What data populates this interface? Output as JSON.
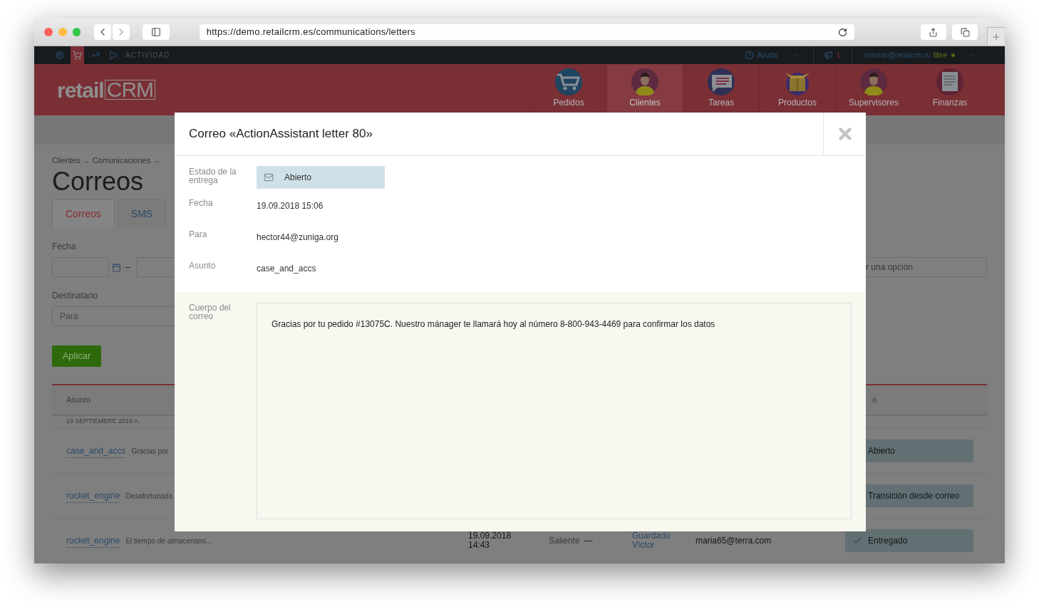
{
  "browser": {
    "url": "https://demo.retailcrm.es/communications/letters"
  },
  "topbar": {
    "icons": [
      {
        "kind": "gear",
        "selected": false
      },
      {
        "kind": "cart",
        "selected": true
      },
      {
        "kind": "chart",
        "selected": false
      },
      {
        "kind": "play",
        "selected": false
      }
    ],
    "section": "ACTIVIDAD",
    "help": "Ayuda",
    "notifications": "1",
    "user": "voronin@retailcrm.ru",
    "plan": "libre"
  },
  "header": {
    "logo_left": "retail",
    "logo_right": "CRM",
    "nav": [
      {
        "label": "Pedidos",
        "kind": "cart",
        "selected": false
      },
      {
        "label": "Clientes",
        "kind": "person",
        "selected": true
      },
      {
        "label": "Tareas",
        "kind": "chat",
        "selected": false
      },
      {
        "label": "Productos",
        "kind": "box",
        "selected": false
      },
      {
        "label": "Supervisores",
        "kind": "person",
        "selected": false
      },
      {
        "label": "Finanzas",
        "kind": "document",
        "selected": false
      }
    ]
  },
  "page": {
    "breadcrumb": "Clientes → Comunicaciones →",
    "title": "Correos",
    "tabs": [
      {
        "label": "Correos",
        "selected": true
      },
      {
        "label": "SMS",
        "selected": false
      }
    ],
    "filters": {
      "date_label": "Fecha",
      "dash": "–",
      "recipient_label": "Destinatario",
      "recipient_placeholder": "Para",
      "select_placeholder": "r una opción",
      "apply": "Aplicar"
    },
    "table": {
      "column_1": "Asunto",
      "column_6": "o",
      "group": "19 SEPTIEMBRE 2018 A.",
      "rows": [
        {
          "subject": "case_and_accs",
          "preview": "Gracias por",
          "status": "Abierto",
          "kind": "plain"
        },
        {
          "subject": "rocket_engine",
          "preview": "Desafortunada",
          "status": "Transición desde correo",
          "kind": "plain"
        },
        {
          "subject": "rocket_engine",
          "preview": "El tiempo de almacenami...",
          "date": "19.09.2018",
          "time": "14:43",
          "direction": "Saliente",
          "dash": "—",
          "manager_first": "Guardado",
          "manager_last": "Víctor",
          "email": "maria65@terra.com",
          "status": "Entregado",
          "kind": "checked"
        }
      ]
    }
  },
  "modal": {
    "title": "Correo «ActionAssistant letter 80»",
    "fields": [
      {
        "label": "Estado de la entrega",
        "kind": "status",
        "value": "Abierto"
      },
      {
        "label": "Fecha",
        "kind": "text",
        "value": "19.09.2018 15:06"
      },
      {
        "label": "Para",
        "kind": "text",
        "value": "hector44@zuniga.org"
      },
      {
        "label": "Asunto",
        "kind": "text",
        "value": "case_and_accs"
      }
    ],
    "body_label": "Cuerpo del correo",
    "body": "Gracias por tu pedido #13075C. Nuestro mánager te llamará hoy al número 8-800-943-4469 para confirmar los datos"
  }
}
